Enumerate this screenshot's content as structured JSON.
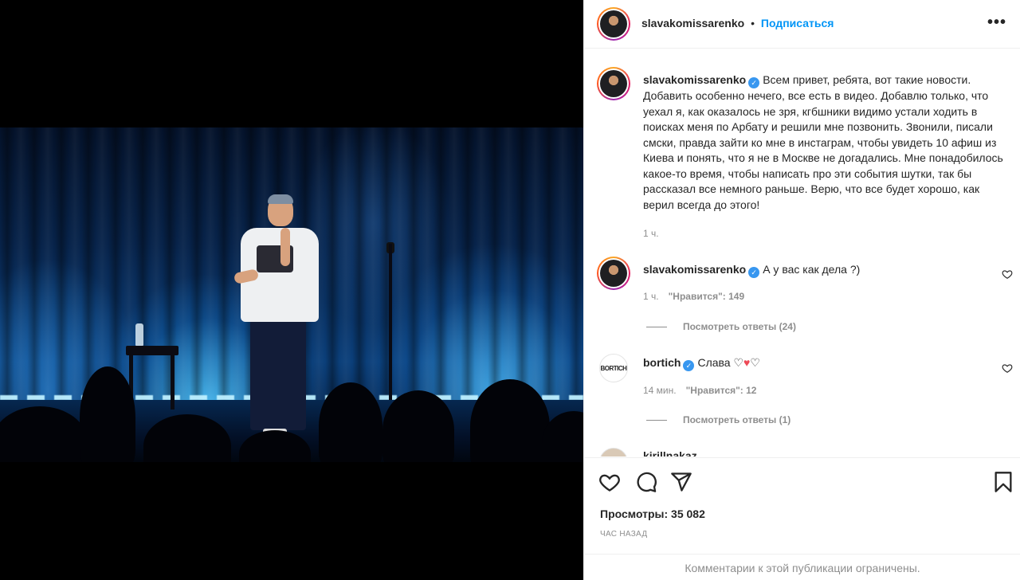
{
  "post": {
    "author": "slavakomissarenko",
    "follow_label": "Подписаться",
    "separator": "•",
    "more_label": "•••"
  },
  "caption": {
    "username": "slavakomissarenko",
    "text": "Всем привет, ребята, вот такие новости. Добавить особенно нечего, все есть в видео. Добавлю только, что уехал я, как оказалось не зря, кгбшники видимо устали ходить в поисках меня по Арбату и решили мне позвонить. Звонили, писали смски, правда зайти ко мне в инстаграм, чтобы увидеть 10 афиш из Киева и понять, что я не в Москве не догадались. Мне понадобилось какое-то время, чтобы написать про эти события шутки, так бы рассказал все немного раньше. Верю, что все будет хорошо, как верил всегда до этого!",
    "time": "1 ч."
  },
  "comments": [
    {
      "username": "slavakomissarenko",
      "text": "А у вас как дела ?)",
      "time": "1 ч.",
      "likes": "\"Нравится\": 149",
      "replies": "Посмотреть ответы (24)"
    },
    {
      "username": "bortich",
      "text": "Слава ♡♥♡",
      "time": "14 мин.",
      "likes": "\"Нравится\": 12",
      "replies": "Посмотреть ответы (1)",
      "avatar_text": "BORTICH"
    }
  ],
  "partial_comment": {
    "username": "kirillnakaz"
  },
  "actions": {
    "views": "Просмотры: 35 082",
    "time_ago": "час назад",
    "comments_limited": "Комментарии к этой публикации ограничены."
  },
  "colors": {
    "accent": "#0095f6",
    "verified": "#3897f0",
    "muted": "#8e8e8e",
    "heart_red": "#ed4956"
  }
}
